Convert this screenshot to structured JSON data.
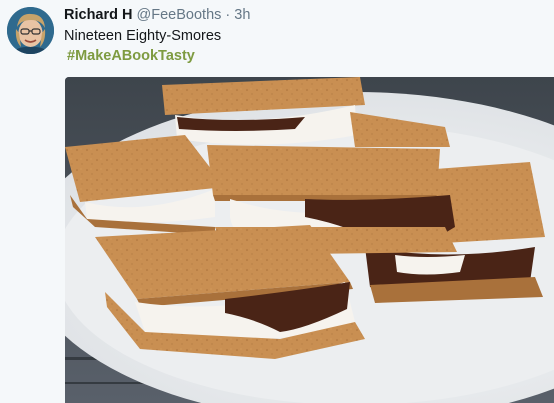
{
  "tweet": {
    "author_name": "Richard H",
    "handle": "@FeeBooths",
    "separator": "·",
    "time": "3h",
    "text": "Nineteen Eighty-Smores",
    "hashtag": "#MakeABookTasty"
  },
  "media": {
    "description_icon": "photo-smores",
    "colors": {
      "cracker": "#c98f52",
      "cracker_dark": "#a9713b",
      "marshmallow": "#f6f3ee",
      "chocolate": "#4a2416",
      "plate": "#f1f2f3",
      "wood": "#4a5158"
    }
  },
  "colors": {
    "hashtag": "#7e9b41",
    "text": "#14171a",
    "meta": "#657786"
  }
}
